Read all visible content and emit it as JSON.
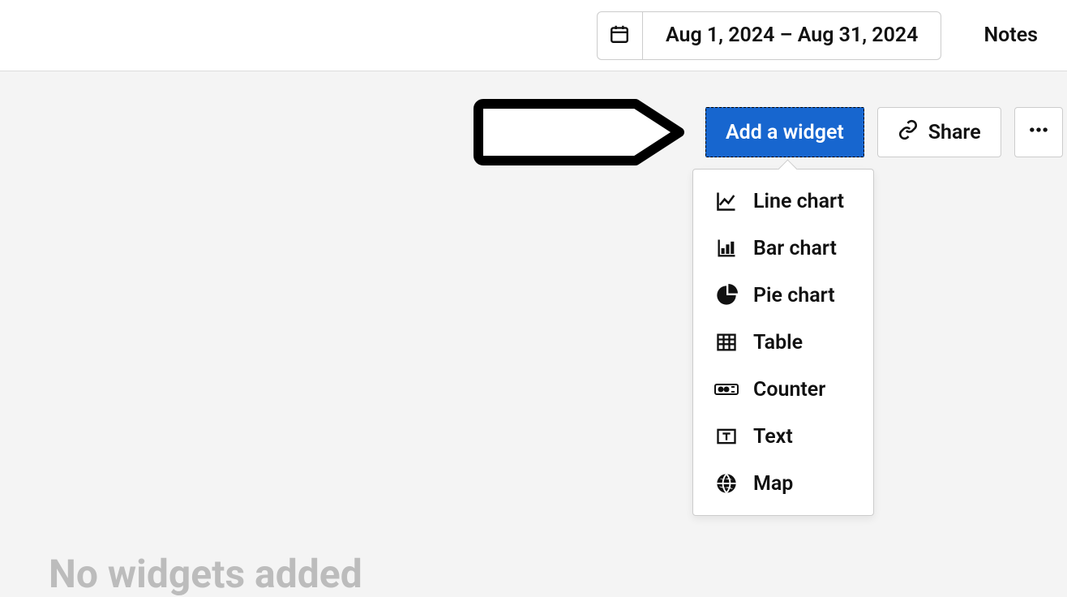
{
  "header": {
    "date_range": "Aug 1, 2024 – Aug 31, 2024",
    "notes_label": "Notes"
  },
  "toolbar": {
    "add_widget_label": "Add a widget",
    "share_label": "Share"
  },
  "dropdown": {
    "items": [
      {
        "label": "Line chart"
      },
      {
        "label": "Bar chart"
      },
      {
        "label": "Pie chart"
      },
      {
        "label": "Table"
      },
      {
        "label": "Counter"
      },
      {
        "label": "Text"
      },
      {
        "label": "Map"
      }
    ]
  },
  "empty_state": "No widgets added"
}
